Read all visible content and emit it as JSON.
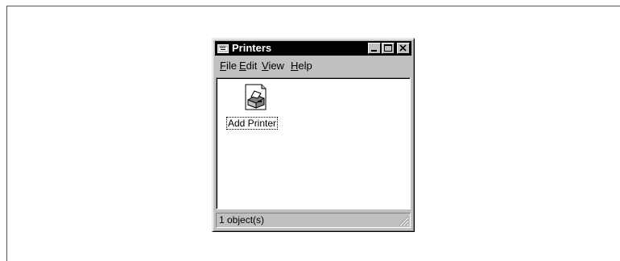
{
  "window": {
    "title": "Printers",
    "controls": {
      "minimize": "minimize",
      "maximize": "maximize",
      "close": "close"
    }
  },
  "menu": [
    {
      "underline": "F",
      "rest": "ile"
    },
    {
      "underline": "E",
      "rest": "dit"
    },
    {
      "underline": "V",
      "rest": "iew"
    },
    {
      "underline": "H",
      "rest": "elp"
    }
  ],
  "items": [
    {
      "label": "Add Printer",
      "icon": "add-printer-icon"
    }
  ],
  "status": {
    "text": "1 object(s)"
  },
  "colors": {
    "titlebar": "#000000",
    "chrome": "#c0c0c0",
    "content": "#ffffff"
  }
}
